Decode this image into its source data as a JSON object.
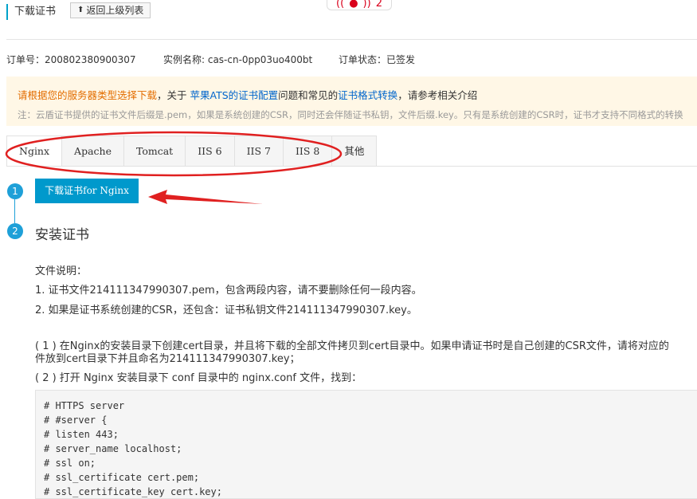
{
  "header": {
    "title": "下载证书",
    "back_label": "返回上级列表",
    "badge_count": "2"
  },
  "order": {
    "order_no": "订单号：20080238090030​7",
    "instance_name": "实例名称: cas-cn-0pp03uo400bt",
    "status": "订单状态：已签发"
  },
  "notice": {
    "line1_orange": "请根据您的服务器类型选择下载",
    "line1_text1": "，关于 ",
    "line1_link1": "苹果ATS的证书配置",
    "line1_text2": "问题和常见的",
    "line1_link2": "证书格式转换",
    "line1_text3": "，请参考相关介绍",
    "line2": "注：云盾证书提供的证书文件后缀是.pem，如果是系统创建的CSR，同时还会伴随证书私钥，文件后缀.key。只有是系统创建的CSR时，证书才支持不同格式的转换"
  },
  "tabs": [
    "Nginx",
    "Apache",
    "Tomcat",
    "IIS 6",
    "IIS 7",
    "IIS 8",
    "其他"
  ],
  "steps": {
    "step1_num": "1",
    "step2_num": "2",
    "download_button": "下载证书for Nginx",
    "step2_title": "安装证书"
  },
  "instructions": {
    "file_desc": "文件说明：",
    "item1": "1. 证书文件214111347990307.pem，包含两段内容，请不要删除任何一段内容。",
    "item2": "2. 如果是证书系统创建的CSR，还包含：证书私钥文件214111347990307.key。",
    "para1a": "( 1 ) 在Nginx的安装目录下创建cert目录，并且将下载的全部文件拷贝到cert目录中。如果申请证书时是自己创建的CSR文件，请将对应的",
    "para1b": "件放到cert目录下并且命名为214111347990307.key；",
    "para2": "( 2 ) 打开 Nginx 安装目录下 conf 目录中的 nginx.conf 文件，找到："
  },
  "code_lines": [
    "# HTTPS server",
    "# #server {",
    "# listen 443;",
    "# server_name localhost;",
    "# ssl on;",
    "# ssl_certificate cert.pem;",
    "# ssl_certificate_key cert.key;"
  ],
  "colors": {
    "accent": "#0099cc",
    "annotation_red": "#e02020",
    "notice_bg": "#fff7e6"
  }
}
